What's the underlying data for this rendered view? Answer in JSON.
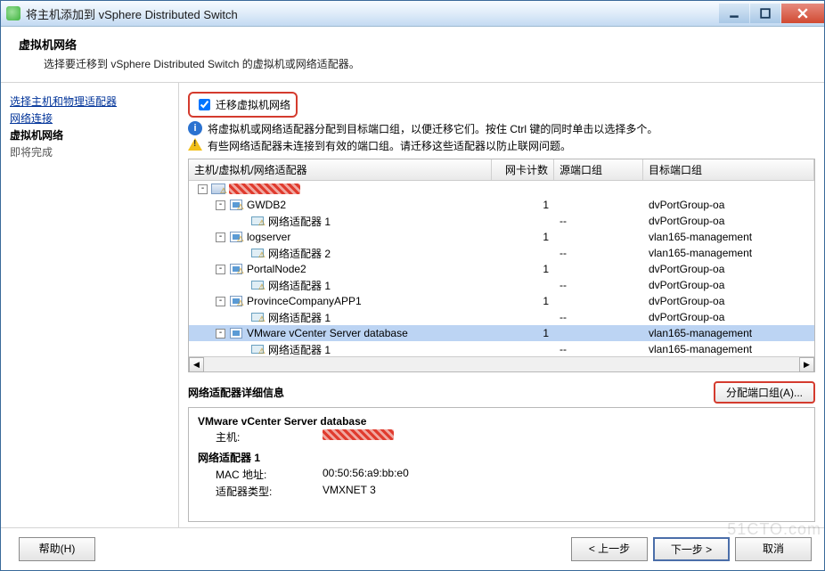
{
  "window": {
    "title": "将主机添加到 vSphere Distributed Switch"
  },
  "header": {
    "title": "虚拟机网络",
    "subtitle": "选择要迁移到 vSphere Distributed Switch 的虚拟机或网络适配器。"
  },
  "sidebar": {
    "step1": "选择主机和物理适配器",
    "step2": "网络连接",
    "step3": "虚拟机网络",
    "step4": "即将完成"
  },
  "main": {
    "checkbox_label": "迁移虚拟机网络",
    "info_text": "将虚拟机或网络适配器分配到目标端口组，以便迁移它们。按住 Ctrl 键的同时单击以选择多个。",
    "warn_text": "有些网络适配器未连接到有效的端口组。请迁移这些适配器以防止联网问题。",
    "columns": {
      "c1": "主机/虚拟机/网络适配器",
      "c2": "网卡计数",
      "c3": "源端口组",
      "c4": "目标端口组"
    },
    "rows": [
      {
        "indent": 0,
        "toggle": "-",
        "icon": "host",
        "warn": true,
        "label": "__REDACTED__",
        "count": "",
        "src": "",
        "dst": ""
      },
      {
        "indent": 1,
        "toggle": "-",
        "icon": "vm",
        "warn": true,
        "label": "GWDB2",
        "count": "1",
        "src": "",
        "dst": "dvPortGroup-oa"
      },
      {
        "indent": 2,
        "toggle": "",
        "icon": "net",
        "warn": true,
        "label": "网络适配器 1",
        "count": "",
        "src": "--",
        "dst": "dvPortGroup-oa"
      },
      {
        "indent": 1,
        "toggle": "-",
        "icon": "vm",
        "warn": true,
        "label": "logserver",
        "count": "1",
        "src": "",
        "dst": "vlan165-management"
      },
      {
        "indent": 2,
        "toggle": "",
        "icon": "net",
        "warn": true,
        "label": "网络适配器 2",
        "count": "",
        "src": "--",
        "dst": "vlan165-management"
      },
      {
        "indent": 1,
        "toggle": "-",
        "icon": "vm",
        "warn": true,
        "label": "PortalNode2",
        "count": "1",
        "src": "",
        "dst": "dvPortGroup-oa"
      },
      {
        "indent": 2,
        "toggle": "",
        "icon": "net",
        "warn": true,
        "label": "网络适配器 1",
        "count": "",
        "src": "--",
        "dst": "dvPortGroup-oa"
      },
      {
        "indent": 1,
        "toggle": "-",
        "icon": "vm",
        "warn": true,
        "label": "ProvinceCompanyAPP1",
        "count": "1",
        "src": "",
        "dst": "dvPortGroup-oa"
      },
      {
        "indent": 2,
        "toggle": "",
        "icon": "net",
        "warn": true,
        "label": "网络适配器 1",
        "count": "",
        "src": "--",
        "dst": "dvPortGroup-oa"
      },
      {
        "indent": 1,
        "toggle": "-",
        "icon": "vm",
        "warn": false,
        "label": "VMware vCenter Server database",
        "count": "1",
        "src": "",
        "dst": "vlan165-management",
        "selected": true
      },
      {
        "indent": 2,
        "toggle": "",
        "icon": "net",
        "warn": true,
        "label": "网络适配器 1",
        "count": "",
        "src": "--",
        "dst": "vlan165-management"
      }
    ],
    "details_section_title": "网络适配器详细信息",
    "assign_button": "分配端口组(A)...",
    "details": {
      "vm_name": "VMware vCenter Server database",
      "host_label": "主机:",
      "adapter_heading": "网络适配器 1",
      "mac_label": "MAC 地址:",
      "mac_value": "00:50:56:a9:bb:e0",
      "type_label": "适配器类型:",
      "type_value": "VMXNET 3"
    }
  },
  "footer": {
    "help": "帮助(H)",
    "back": "< 上一步",
    "next": "下一步 >",
    "cancel": "取消"
  },
  "watermark": "51CTO.com"
}
